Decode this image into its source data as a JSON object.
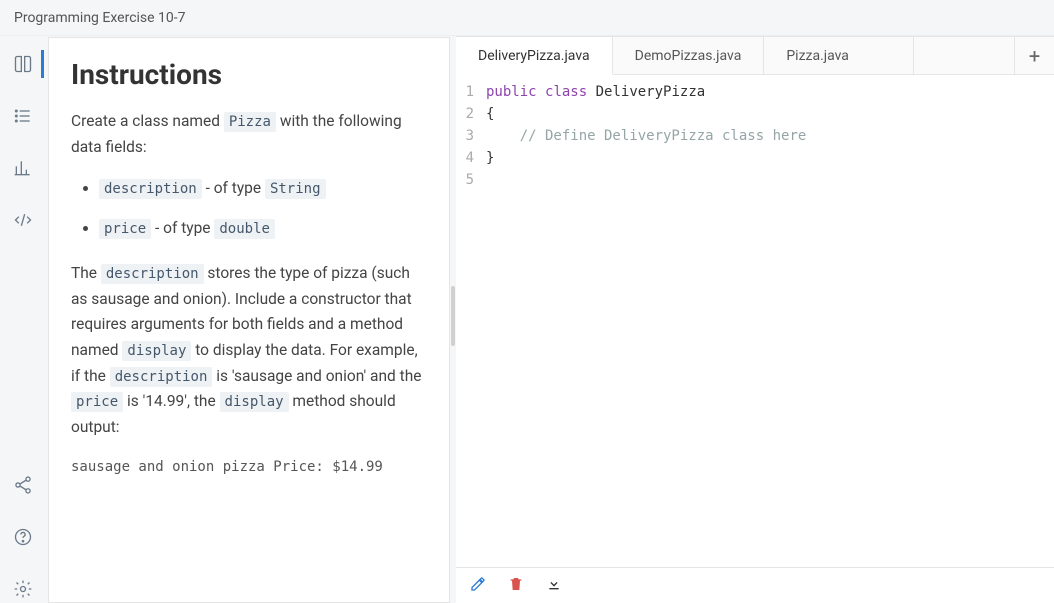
{
  "header": {
    "title": "Programming Exercise 10-7"
  },
  "iconbar": {
    "items": [
      {
        "name": "book-icon"
      },
      {
        "name": "list-icon"
      },
      {
        "name": "chart-icon"
      },
      {
        "name": "code-icon"
      }
    ],
    "bottom": [
      {
        "name": "share-icon"
      },
      {
        "name": "help-icon"
      },
      {
        "name": "gear-icon"
      }
    ]
  },
  "instructions": {
    "heading": "Instructions",
    "p1_a": "Create a class named ",
    "p1_code1": "Pizza",
    "p1_b": " with the following data fields:",
    "bullets": [
      {
        "code": "description",
        "text": " - of type ",
        "code2": "String"
      },
      {
        "code": "price",
        "text": " - of type ",
        "code2": "double"
      }
    ],
    "p2_a": "The ",
    "p2_code1": "description",
    "p2_b": " stores the type of pizza (such as sausage and onion). Include a constructor that requires arguments for both fields and a method named ",
    "p2_code2": "display",
    "p2_c": " to display the data. For example, if the ",
    "p2_code3": "description",
    "p2_d": " is 'sausage and onion' and the ",
    "p2_code4": "price",
    "p2_e": " is '14.99', the ",
    "p2_code5": "display",
    "p2_f": " method should output:",
    "output": "sausage and onion pizza Price: $14.99"
  },
  "tabs": [
    {
      "label": "DeliveryPizza.java",
      "active": true
    },
    {
      "label": "DemoPizzas.java",
      "active": false
    },
    {
      "label": "Pizza.java",
      "active": false
    }
  ],
  "code": {
    "lines": [
      {
        "n": "1",
        "html": "<span class='kw'>public</span> <span class='kw'>class</span> DeliveryPizza"
      },
      {
        "n": "2",
        "html": "{"
      },
      {
        "n": "3",
        "html": "    <span class='cm'>// Define DeliveryPizza class here</span>"
      },
      {
        "n": "4",
        "html": "}"
      },
      {
        "n": "5",
        "html": ""
      }
    ]
  },
  "toolbar": {
    "items": [
      {
        "name": "edit-icon",
        "color": "#2b7cd3"
      },
      {
        "name": "trash-icon",
        "color": "#d9534f"
      },
      {
        "name": "download-icon",
        "color": "#333"
      }
    ]
  }
}
